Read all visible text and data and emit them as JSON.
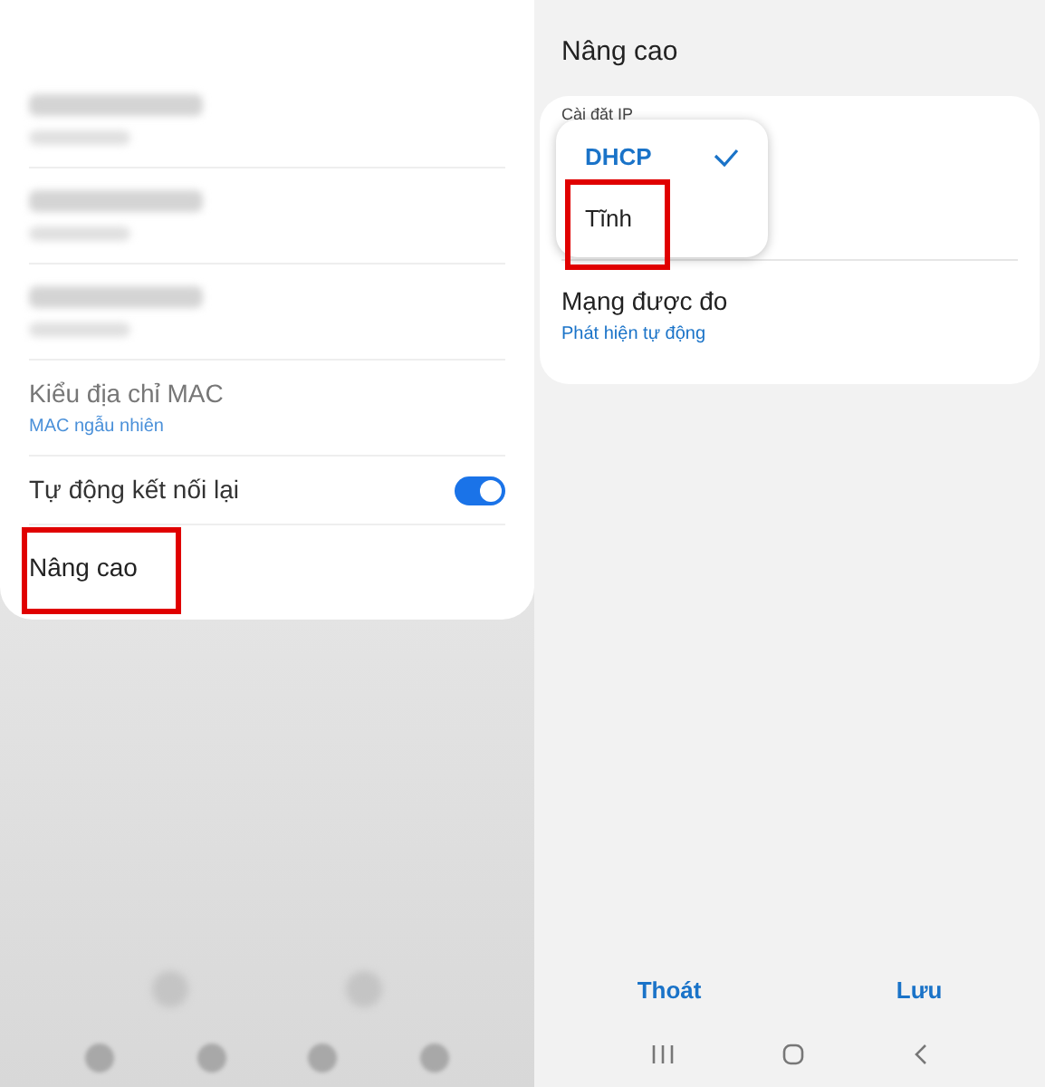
{
  "left_screen": {
    "rows": [
      {
        "kind": "text",
        "title": "Kiểu địa chỉ MAC",
        "subtitle": "MAC ngẫu nhiên"
      },
      {
        "kind": "toggle",
        "title": "Tự động kết nối lại",
        "on": true
      },
      {
        "kind": "link",
        "title": "Nâng cao",
        "highlighted": true
      }
    ]
  },
  "right_screen": {
    "title": "Nâng cao",
    "section_label": "Cài đặt IP",
    "dropdown": [
      {
        "label": "DHCP",
        "selected": true,
        "highlighted": false
      },
      {
        "label": "Tĩnh",
        "selected": false,
        "highlighted": true
      }
    ],
    "rows": [
      {
        "title": "Mạng được đo",
        "subtitle": "Phát hiện tự động"
      }
    ],
    "buttons": [
      "Thoát",
      "Lưu"
    ]
  }
}
